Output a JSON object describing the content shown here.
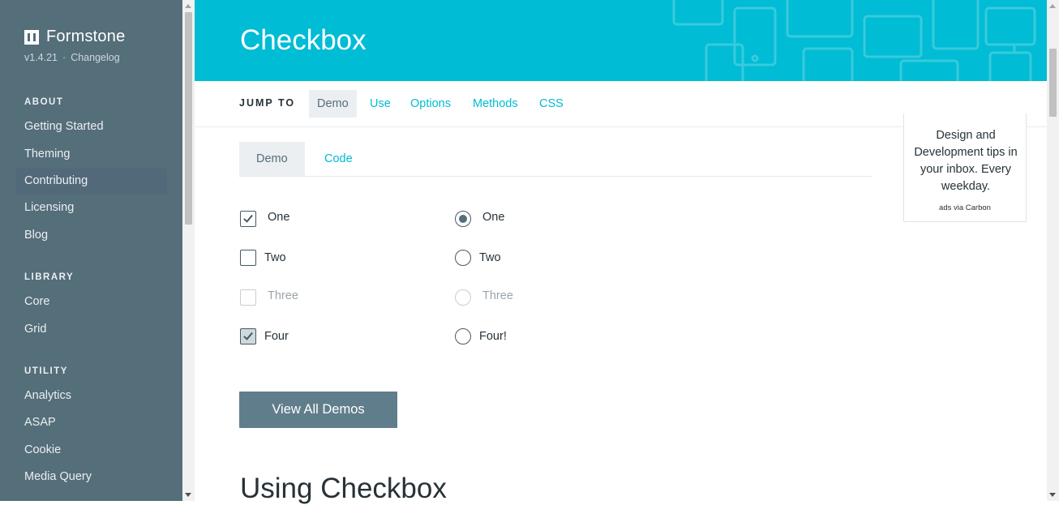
{
  "sidebar": {
    "brand": "Formstone",
    "version": "v1.4.21",
    "separator": "·",
    "changelog": "Changelog",
    "sections": [
      {
        "heading": "ABOUT",
        "items": [
          "Getting Started",
          "Theming",
          "Contributing",
          "Licensing",
          "Blog"
        ]
      },
      {
        "heading": "LIBRARY",
        "items": [
          "Core",
          "Grid"
        ]
      },
      {
        "heading": "UTILITY",
        "items": [
          "Analytics",
          "ASAP",
          "Cookie",
          "Media Query"
        ]
      }
    ]
  },
  "header": {
    "title": "Checkbox"
  },
  "jump": {
    "label": "JUMP TO",
    "links": [
      "Demo",
      "Use",
      "Options",
      "Methods",
      "CSS"
    ],
    "active": "Demo"
  },
  "ad": {
    "text": "Design and Development tips in your inbox. Every weekday.",
    "via": "ads via Carbon"
  },
  "demo": {
    "tabs": [
      "Demo",
      "Code"
    ],
    "checkboxes": [
      {
        "label": "One",
        "checked": true,
        "disabled": false
      },
      {
        "label": "Two",
        "checked": false,
        "disabled": false
      },
      {
        "label": "Three",
        "checked": false,
        "disabled": true
      },
      {
        "label": "Four",
        "checked": true,
        "disabled": false
      }
    ],
    "radios": [
      {
        "label": "One",
        "checked": true,
        "disabled": false
      },
      {
        "label": "Two",
        "checked": false,
        "disabled": false
      },
      {
        "label": "Three",
        "checked": false,
        "disabled": true
      },
      {
        "label": "Four!",
        "checked": false,
        "disabled": false
      }
    ],
    "button": "View All Demos"
  },
  "section": {
    "heading": "Using Checkbox"
  },
  "colors": {
    "sidebar": "#546e7a",
    "header": "#00bcd4",
    "accent": "#00bcd4",
    "button": "#607d8b"
  }
}
